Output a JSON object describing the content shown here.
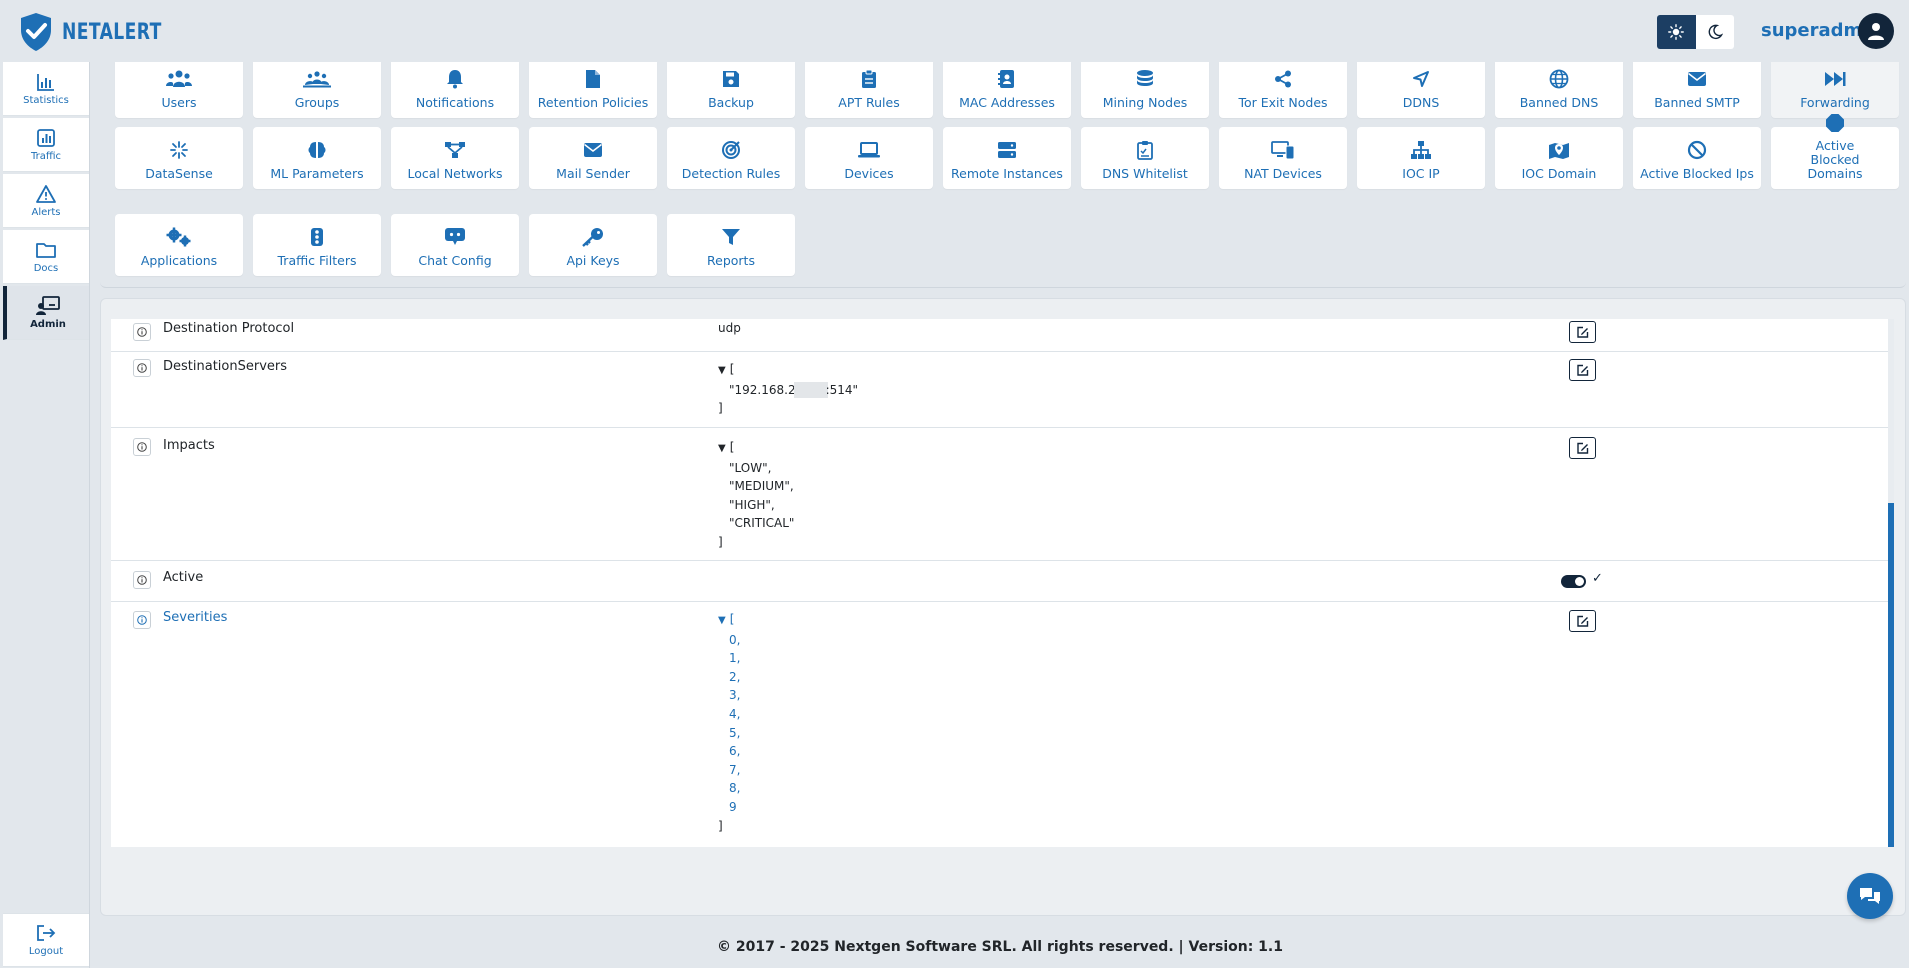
{
  "header": {
    "brand": "NETALERT",
    "username": "superadmin"
  },
  "sidebar": {
    "items": [
      {
        "label": "Statistics",
        "icon": "chart-bar-icon"
      },
      {
        "label": "Traffic",
        "icon": "traffic-chart-icon"
      },
      {
        "label": "Alerts",
        "icon": "warning-triangle-icon"
      },
      {
        "label": "Docs",
        "icon": "folder-icon"
      },
      {
        "label": "Admin",
        "icon": "admin-board-icon"
      }
    ],
    "logout_label": "Logout"
  },
  "tiles": [
    {
      "label": "Users",
      "icon": "users-icon"
    },
    {
      "label": "Groups",
      "icon": "groups-icon"
    },
    {
      "label": "Notifications",
      "icon": "bell-icon"
    },
    {
      "label": "Retention Policies",
      "icon": "file-icon"
    },
    {
      "label": "Backup",
      "icon": "floppy-disk-icon"
    },
    {
      "label": "APT Rules",
      "icon": "clipboard-icon"
    },
    {
      "label": "MAC Addresses",
      "icon": "address-book-icon"
    },
    {
      "label": "Mining Nodes",
      "icon": "coins-icon"
    },
    {
      "label": "Tor Exit Nodes",
      "icon": "share-nodes-icon"
    },
    {
      "label": "DDNS",
      "icon": "location-arrow-icon"
    },
    {
      "label": "Banned DNS",
      "icon": "globe-icon"
    },
    {
      "label": "Banned SMTP",
      "icon": "envelope-icon"
    },
    {
      "label": "Forwarding",
      "icon": "forward-icon"
    },
    {
      "label": "DataSense",
      "icon": "sparkle-icon"
    },
    {
      "label": "ML Parameters",
      "icon": "brain-icon"
    },
    {
      "label": "Local Networks",
      "icon": "network-icon"
    },
    {
      "label": "Mail Sender",
      "icon": "envelope-icon"
    },
    {
      "label": "Detection Rules",
      "icon": "target-icon"
    },
    {
      "label": "Devices",
      "icon": "laptop-icon"
    },
    {
      "label": "Remote Instances",
      "icon": "server-icon"
    },
    {
      "label": "DNS Whitelist",
      "icon": "clipboard-check-icon"
    },
    {
      "label": "NAT Devices",
      "icon": "desktop-mobile-icon"
    },
    {
      "label": "IOC IP",
      "icon": "sitemap-icon"
    },
    {
      "label": "IOC Domain",
      "icon": "map-marker-icon"
    },
    {
      "label": "Active Blocked Ips",
      "icon": "ban-icon"
    },
    {
      "label": "Active Blocked Domains",
      "icon": "octagon-icon"
    },
    {
      "label": "Applications",
      "icon": "gears-icon"
    },
    {
      "label": "Traffic Filters",
      "icon": "traffic-light-icon"
    },
    {
      "label": "Chat Config",
      "icon": "chat-bot-icon"
    },
    {
      "label": "Api Keys",
      "icon": "key-icon"
    },
    {
      "label": "Reports",
      "icon": "filter-icon"
    }
  ],
  "settings": {
    "rows": [
      {
        "label": "Destination Protocol",
        "value": "udp"
      },
      {
        "label": "DestinationServers",
        "open": "[",
        "item_prefix": "\"192.168.2",
        "item_suffix": ":514\"",
        "close": "]"
      },
      {
        "label": "Impacts",
        "open": "[",
        "items": [
          "\"LOW\",",
          "\"MEDIUM\",",
          "\"HIGH\",",
          "\"CRITICAL\""
        ],
        "close": "]"
      },
      {
        "label": "Active",
        "checked": true,
        "check_glyph": "✓"
      },
      {
        "label": "Severities",
        "open": "[",
        "items": [
          "0,",
          "1,",
          "2,",
          "3,",
          "4,",
          "5,",
          "6,",
          "7,",
          "8,",
          "9"
        ],
        "close": "]"
      }
    ]
  },
  "footer": {
    "text": "© 2017 - 2025 Nextgen Software SRL. All rights reserved. | Version: 1.1"
  },
  "colors": {
    "brand_blue": "#1e6fb5",
    "navy": "#12253a",
    "background": "#e2e7ec"
  }
}
